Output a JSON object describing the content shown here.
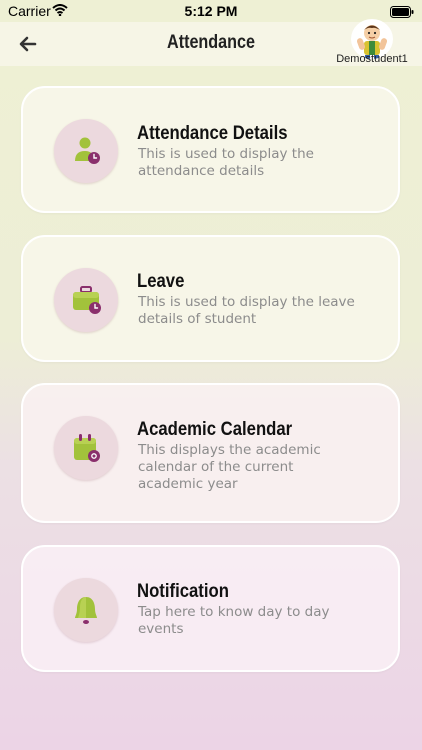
{
  "status_bar": {
    "carrier": "Carrier",
    "time": "5:12 PM",
    "wifi_icon": "wifi-icon",
    "battery_icon": "battery-icon"
  },
  "header": {
    "title": "Attendance",
    "back_icon": "arrow-left-icon",
    "username": "Demostudent1"
  },
  "cards": [
    {
      "title": "Attendance Details",
      "description": "This is used to display the attendance details",
      "icon": "person-clock-icon"
    },
    {
      "title": "Leave",
      "description": "This is used to display the leave details of student",
      "icon": "suitcase-clock-icon"
    },
    {
      "title": "Academic Calendar",
      "description": "This displays the academic calendar of the current academic year",
      "icon": "calendar-icon"
    },
    {
      "title": "Notification",
      "description": "Tap here to know day to day events",
      "icon": "bell-icon"
    }
  ],
  "colors": {
    "accent_green": "#a2c23b",
    "accent_purple": "#8a2f6c",
    "icon_circle": "#ecd9de"
  }
}
